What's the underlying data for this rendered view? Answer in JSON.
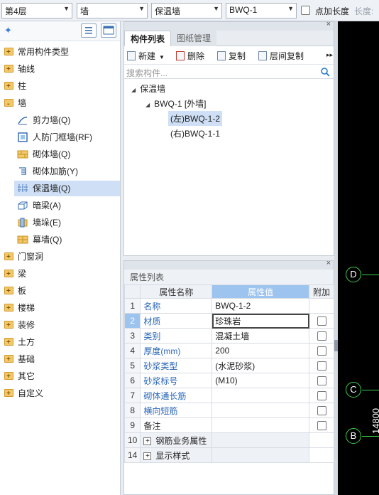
{
  "toolbar": {
    "floor": "第4层",
    "category": "墙",
    "type": "保温墙",
    "component": "BWQ-1",
    "point_length_label": "点加长度",
    "length_label": "长度:"
  },
  "left_tree": {
    "items": [
      {
        "label": "常用构件类型"
      },
      {
        "label": "轴线"
      },
      {
        "label": "柱"
      },
      {
        "label": "墙"
      },
      {
        "label": "剪力墙(Q)"
      },
      {
        "label": "人防门框墙(RF)"
      },
      {
        "label": "砌体墙(Q)"
      },
      {
        "label": "砌体加筋(Y)"
      },
      {
        "label": "保温墙(Q)"
      },
      {
        "label": "暗梁(A)"
      },
      {
        "label": "墙垛(E)"
      },
      {
        "label": "幕墙(Q)"
      },
      {
        "label": "门窗洞"
      },
      {
        "label": "梁"
      },
      {
        "label": "板"
      },
      {
        "label": "楼梯"
      },
      {
        "label": "装修"
      },
      {
        "label": "土方"
      },
      {
        "label": "基础"
      },
      {
        "label": "其它"
      },
      {
        "label": "自定义"
      }
    ]
  },
  "component_panel": {
    "tabs": [
      "构件列表",
      "图纸管理"
    ],
    "actions": {
      "new": "新建",
      "delete": "删除",
      "copy": "复制",
      "floor_copy": "层间复制"
    },
    "search_placeholder": "搜索构件...",
    "tree": {
      "root": "保温墙",
      "child": "BWQ-1 [外墙]",
      "leaf1": "(左)BWQ-1-2",
      "leaf2": "(右)BWQ-1-1"
    }
  },
  "properties": {
    "title": "属性列表",
    "headers": {
      "name": "属性名称",
      "value": "属性值",
      "extra": "附加"
    },
    "rows": [
      {
        "num": "1",
        "name": "名称",
        "value": "BWQ-1-2"
      },
      {
        "num": "2",
        "name": "材质",
        "value": "珍珠岩"
      },
      {
        "num": "3",
        "name": "类别",
        "value": "混凝土墙"
      },
      {
        "num": "4",
        "name": "厚度(mm)",
        "value": "200"
      },
      {
        "num": "5",
        "name": "砂浆类型",
        "value": "(水泥砂浆)"
      },
      {
        "num": "6",
        "name": "砂浆标号",
        "value": "(M10)"
      },
      {
        "num": "7",
        "name": "砌体通长筋",
        "value": ""
      },
      {
        "num": "8",
        "name": "横向短筋",
        "value": ""
      },
      {
        "num": "9",
        "name": "备注",
        "value": ""
      },
      {
        "num": "10",
        "name": "钢筋业务属性",
        "value": ""
      },
      {
        "num": "14",
        "name": "显示样式",
        "value": ""
      }
    ]
  },
  "canvas": {
    "axis_d": "D",
    "axis_c": "C",
    "axis_b": "B",
    "dimension": "14800"
  }
}
